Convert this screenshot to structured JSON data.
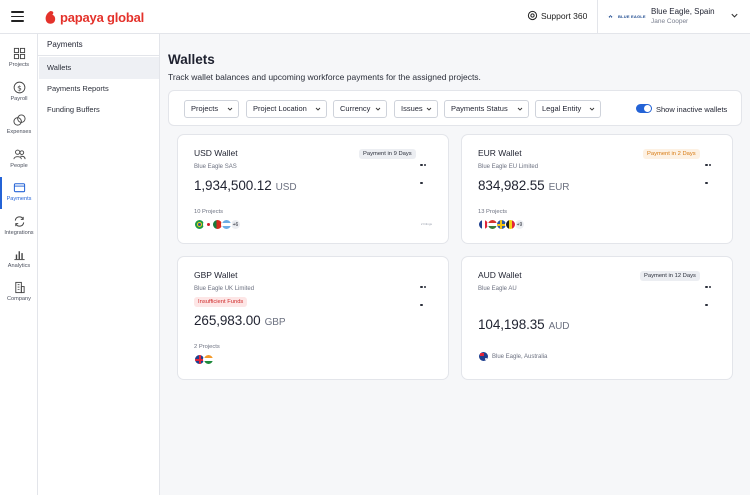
{
  "header": {
    "logo_text": "papaya global",
    "support_label": "Support 360",
    "brand_text": "BLUE EAGLE",
    "account_name": "Blue Eagle, Spain",
    "account_user": "Jane Cooper"
  },
  "rail": {
    "items": [
      {
        "label": "Projects",
        "icon": "grid-icon"
      },
      {
        "label": "Payroll",
        "icon": "dollar-circle-icon"
      },
      {
        "label": "Expenses",
        "icon": "coins-icon"
      },
      {
        "label": "People",
        "icon": "people-icon"
      },
      {
        "label": "Payments",
        "icon": "wallet-icon"
      },
      {
        "label": "Integrations",
        "icon": "sync-icon"
      },
      {
        "label": "Analytics",
        "icon": "bar-chart-icon"
      },
      {
        "label": "Company",
        "icon": "building-icon"
      }
    ],
    "active": "Payments"
  },
  "subnav": {
    "title": "Payments",
    "items": [
      "Wallets",
      "Payments Reports",
      "Funding Buffers"
    ],
    "active": "Wallets"
  },
  "page": {
    "title": "Wallets",
    "description": "Track wallet balances and upcoming workforce payments for the assigned projects."
  },
  "filters": {
    "chips": [
      "Projects",
      "Project Location",
      "Currency",
      "Issues",
      "Payments Status",
      "Legal Entity"
    ],
    "toggle_label": "Show inactive wallets",
    "toggle_on": true
  },
  "wallets": [
    {
      "name": "USD Wallet",
      "entity": "Blue Eagle SAS",
      "amount": "1,934,500.12",
      "currency": "USD",
      "badge": "Payment in 9 Days",
      "projects": "10 Projects",
      "more_count": "+6",
      "note": "2 Filings"
    },
    {
      "name": "EUR Wallet",
      "entity": "Blue Eagle EU Limited",
      "amount": "834,982.55",
      "currency": "EUR",
      "badge": "Payment in 2 Days",
      "projects": "13 Projects",
      "more_count": "+9"
    },
    {
      "name": "GBP Wallet",
      "entity": "Blue Eagle UK Limited",
      "amount": "265,983.00",
      "currency": "GBP",
      "badge": "Insufficient Funds",
      "projects": "2 Projects"
    },
    {
      "name": "AUD Wallet",
      "entity": "Blue Eagle AU",
      "amount": "104,198.35",
      "currency": "AUD",
      "badge": "Payment in 12 Days",
      "location": "Blue Eagle, Australia"
    }
  ],
  "colors": {
    "brand": "#e4322b",
    "accent": "#2463d6",
    "warning": "#d77a12",
    "danger": "#cf2a2a"
  }
}
